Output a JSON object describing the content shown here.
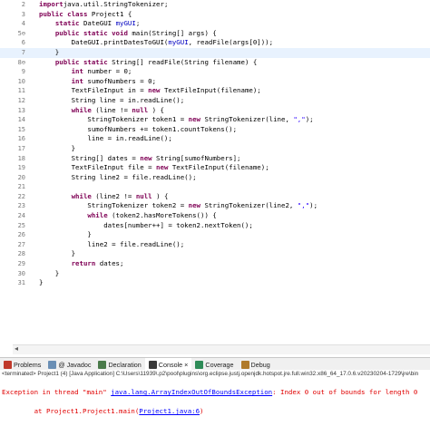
{
  "editor": {
    "lines": [
      {
        "n": "2",
        "marker": "",
        "t": [
          [
            "kw",
            "import"
          ],
          [
            "",
            "java.util.StringTokenizer;"
          ]
        ]
      },
      {
        "n": "3",
        "marker": "",
        "t": [
          [
            "kw",
            "public class"
          ],
          [
            "",
            " Project1 {"
          ]
        ]
      },
      {
        "n": "4",
        "marker": "",
        "t": [
          [
            "",
            "    "
          ],
          [
            "kw",
            "static"
          ],
          [
            "",
            " DateGUI "
          ],
          [
            "field",
            "myGUI"
          ],
          [
            "",
            ";"
          ]
        ]
      },
      {
        "n": "5⊖",
        "marker": "",
        "t": [
          [
            "",
            "    "
          ],
          [
            "kw",
            "public static void"
          ],
          [
            "",
            " main(String[] args) {"
          ]
        ]
      },
      {
        "n": "6",
        "marker": "",
        "t": [
          [
            "",
            "        DateGUI.printDatesToGUI("
          ],
          [
            "field",
            "myGUI"
          ],
          [
            "",
            ", readFile(args[0]));"
          ]
        ]
      },
      {
        "n": "7",
        "marker": "current",
        "t": [
          [
            "",
            "    }"
          ]
        ]
      },
      {
        "n": "8⊖",
        "marker": "",
        "t": [
          [
            "",
            "    "
          ],
          [
            "kw",
            "public static"
          ],
          [
            "",
            " String[] readFile(String filename) {"
          ]
        ]
      },
      {
        "n": "9",
        "marker": "",
        "t": [
          [
            "",
            "        "
          ],
          [
            "kw",
            "int"
          ],
          [
            "",
            " number = 0;"
          ]
        ]
      },
      {
        "n": "10",
        "marker": "",
        "t": [
          [
            "",
            "        "
          ],
          [
            "kw",
            "int"
          ],
          [
            "",
            " sumofNumbers = 0;"
          ]
        ]
      },
      {
        "n": "11",
        "marker": "",
        "t": [
          [
            "",
            "        TextFileInput in = "
          ],
          [
            "kw",
            "new"
          ],
          [
            "",
            " TextFileInput(filename);"
          ]
        ]
      },
      {
        "n": "12",
        "marker": "",
        "t": [
          [
            "",
            "        String line = in.readLine();"
          ]
        ]
      },
      {
        "n": "13",
        "marker": "",
        "t": [
          [
            "",
            "        "
          ],
          [
            "kw",
            "while"
          ],
          [
            "",
            " (line != "
          ],
          [
            "kw",
            "null"
          ],
          [
            "",
            " ) {"
          ]
        ]
      },
      {
        "n": "14",
        "marker": "",
        "t": [
          [
            "",
            "            StringTokenizer token1 = "
          ],
          [
            "kw",
            "new"
          ],
          [
            "",
            " StringTokenizer(line, "
          ],
          [
            "str",
            "\",\""
          ],
          [
            "",
            ");"
          ]
        ]
      },
      {
        "n": "15",
        "marker": "",
        "t": [
          [
            "",
            "            sumofNumbers += token1.countTokens();"
          ]
        ]
      },
      {
        "n": "16",
        "marker": "",
        "t": [
          [
            "",
            "            line = in.readLine();"
          ]
        ]
      },
      {
        "n": "17",
        "marker": "",
        "t": [
          [
            "",
            "        }"
          ]
        ]
      },
      {
        "n": "18",
        "marker": "",
        "t": [
          [
            "",
            "        String[] dates = "
          ],
          [
            "kw",
            "new"
          ],
          [
            "",
            " String[sumofNumbers];"
          ]
        ]
      },
      {
        "n": "19",
        "marker": "",
        "t": [
          [
            "",
            "        TextFileInput file = "
          ],
          [
            "kw",
            "new"
          ],
          [
            "",
            " TextFileInput(filename);"
          ]
        ]
      },
      {
        "n": "20",
        "marker": "",
        "t": [
          [
            "",
            "        String line2 = file.readLine();"
          ]
        ]
      },
      {
        "n": "21",
        "marker": "",
        "t": [
          [
            "",
            ""
          ]
        ]
      },
      {
        "n": "22",
        "marker": "",
        "t": [
          [
            "",
            "        "
          ],
          [
            "kw",
            "while"
          ],
          [
            "",
            " (line2 != "
          ],
          [
            "kw",
            "null"
          ],
          [
            "",
            " ) {"
          ]
        ]
      },
      {
        "n": "23",
        "marker": "",
        "t": [
          [
            "",
            "            StringTokenizer token2 = "
          ],
          [
            "kw",
            "new"
          ],
          [
            "",
            " StringTokenizer(line2, "
          ],
          [
            "str",
            "\",\""
          ],
          [
            "",
            ");"
          ]
        ]
      },
      {
        "n": "24",
        "marker": "",
        "t": [
          [
            "",
            "            "
          ],
          [
            "kw",
            "while"
          ],
          [
            "",
            " (token2.hasMoreTokens()) {"
          ]
        ]
      },
      {
        "n": "25",
        "marker": "",
        "t": [
          [
            "",
            "                dates[number++] = token2.nextToken();"
          ]
        ]
      },
      {
        "n": "26",
        "marker": "",
        "t": [
          [
            "",
            "            }"
          ]
        ]
      },
      {
        "n": "27",
        "marker": "",
        "t": [
          [
            "",
            "            line2 = file.readLine();"
          ]
        ]
      },
      {
        "n": "28",
        "marker": "",
        "t": [
          [
            "",
            "        }"
          ]
        ]
      },
      {
        "n": "29",
        "marker": "",
        "t": [
          [
            "",
            "        "
          ],
          [
            "kw",
            "return"
          ],
          [
            "",
            " dates;"
          ]
        ]
      },
      {
        "n": "30",
        "marker": "",
        "t": [
          [
            "",
            "    }"
          ]
        ]
      },
      {
        "n": "31",
        "marker": "",
        "t": [
          [
            "",
            "}"
          ]
        ]
      }
    ]
  },
  "tabs": [
    {
      "label": "Problems",
      "icon": "problems-icon",
      "color": "#c0392b",
      "active": false
    },
    {
      "label": "@ Javadoc",
      "icon": "javadoc-icon",
      "color": "#6a8fb5",
      "active": false
    },
    {
      "label": "Declaration",
      "icon": "declaration-icon",
      "color": "#4a7a4a",
      "active": false
    },
    {
      "label": "Console ×",
      "icon": "console-icon",
      "color": "#3a3a3a",
      "active": true
    },
    {
      "label": "Coverage",
      "icon": "coverage-icon",
      "color": "#2e8b57",
      "active": false
    },
    {
      "label": "Debug",
      "icon": "debug-icon",
      "color": "#b07a2a",
      "active": false
    }
  ],
  "console": {
    "header": "<terminated> Project1 (4) [Java Application] C:\\Users\\11939\\.p2\\pool\\plugins\\org.eclipse.justj.openjdk.hotspot.jre.full.win32.x86_64_17.0.6.v20230204-1729\\jre\\bin",
    "line1_prefix": "Exception in thread \"main\" ",
    "line1_link": "java.lang.ArrayIndexOutOfBoundsException",
    "line1_suffix": ": Index 0 out of bounds for length 0",
    "line2_prefix": "        at Project1.Project1.main(",
    "line2_link": "Project1.java:6",
    "line2_suffix": ")"
  },
  "colors": {
    "keyword": "#7f0055",
    "string": "#2a00ff",
    "field": "#0000c0",
    "error": "#e00000"
  }
}
